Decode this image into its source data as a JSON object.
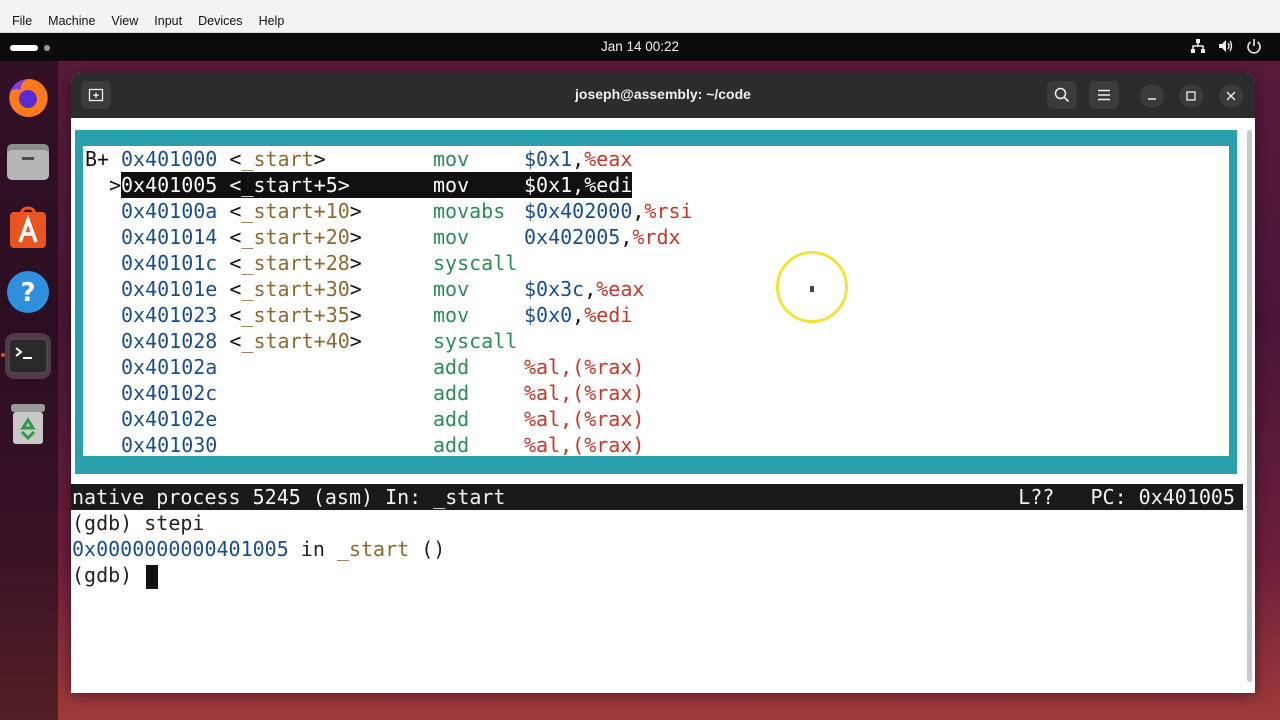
{
  "vbox_menu": [
    "File",
    "Machine",
    "View",
    "Input",
    "Devices",
    "Help"
  ],
  "topbar": {
    "clock": "Jan 14  00:22",
    "tray_icons": [
      "network-icon",
      "volume-icon",
      "power-icon"
    ]
  },
  "dock": {
    "items": [
      {
        "name": "firefox-icon"
      },
      {
        "name": "files-icon"
      },
      {
        "name": "app-center-icon"
      },
      {
        "name": "help-icon"
      },
      {
        "name": "terminal-icon"
      },
      {
        "name": "trash-icon"
      }
    ]
  },
  "window": {
    "title": "joseph@assembly: ~/code"
  },
  "asm": {
    "lines": [
      {
        "marker": "B+",
        "addr": "0x401000",
        "sym_open": " <",
        "sym": "_start",
        "sym_close": ">",
        "mn": "mov",
        "op1": "$0x1",
        "comma": ",",
        "reg": "%eax"
      },
      {
        "marker": "  >",
        "addr": "0x401005",
        "sym_open": " <",
        "sym": "_start+5",
        "sym_close": ">",
        "mn": "mov",
        "op1": "$0x1",
        "comma": ",",
        "reg": "%edi"
      },
      {
        "marker": "",
        "addr": "0x40100a",
        "sym_open": " <",
        "sym": "_start+10",
        "sym_close": ">",
        "mn": "movabs",
        "op1": "$0x402000",
        "comma": ",",
        "reg": "%rsi"
      },
      {
        "marker": "",
        "addr": "0x401014",
        "sym_open": " <",
        "sym": "_start+20",
        "sym_close": ">",
        "mn": "mov",
        "op1": "0x402005",
        "comma": ",",
        "reg": "%rdx"
      },
      {
        "marker": "",
        "addr": "0x40101c",
        "sym_open": " <",
        "sym": "_start+28",
        "sym_close": ">",
        "mn": "syscall",
        "op1": "",
        "comma": "",
        "reg": ""
      },
      {
        "marker": "",
        "addr": "0x40101e",
        "sym_open": " <",
        "sym": "_start+30",
        "sym_close": ">",
        "mn": "mov",
        "op1": "$0x3c",
        "comma": ",",
        "reg": "%eax"
      },
      {
        "marker": "",
        "addr": "0x401023",
        "sym_open": " <",
        "sym": "_start+35",
        "sym_close": ">",
        "mn": "mov",
        "op1": "$0x0",
        "comma": ",",
        "reg": "%edi"
      },
      {
        "marker": "",
        "addr": "0x401028",
        "sym_open": " <",
        "sym": "_start+40",
        "sym_close": ">",
        "mn": "syscall",
        "op1": "",
        "comma": "",
        "reg": ""
      },
      {
        "marker": "",
        "addr": "0x40102a",
        "sym_open": "",
        "sym": "",
        "sym_close": "",
        "mn": "add",
        "op1": "",
        "comma": "",
        "reg": "%al,(%rax)"
      },
      {
        "marker": "",
        "addr": "0x40102c",
        "sym_open": "",
        "sym": "",
        "sym_close": "",
        "mn": "add",
        "op1": "",
        "comma": "",
        "reg": "%al,(%rax)"
      },
      {
        "marker": "",
        "addr": "0x40102e",
        "sym_open": "",
        "sym": "",
        "sym_close": "",
        "mn": "add",
        "op1": "",
        "comma": "",
        "reg": "%al,(%rax)"
      },
      {
        "marker": "",
        "addr": "0x401030",
        "sym_open": "",
        "sym": "",
        "sym_close": "",
        "mn": "add",
        "op1": "",
        "comma": "",
        "reg": "%al,(%rax)"
      }
    ]
  },
  "status": {
    "left": "native process 5245 (asm) In: _start",
    "right": "L??   PC: 0x401005"
  },
  "console": {
    "line1": "(gdb) stepi",
    "line2_addr": "0x0000000000401005",
    "line2_in": " in ",
    "line2_sym": "_start",
    "line2_tail": " ()",
    "prompt": "(gdb) "
  }
}
